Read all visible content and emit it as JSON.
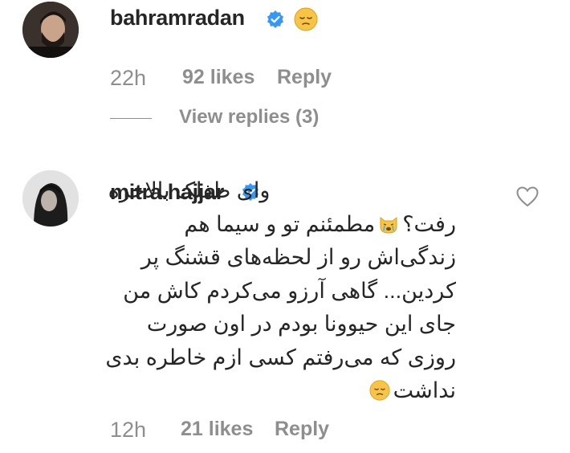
{
  "comments": [
    {
      "username": "bahramradan",
      "verified": true,
      "avatar_icon": "user-avatar",
      "emoji": "pensive-face",
      "time": "22h",
      "likes": "92 likes",
      "reply_label": "Reply",
      "view_replies": "View replies (3)"
    },
    {
      "username": "mitra.hajjar",
      "verified": true,
      "avatar_icon": "user-avatar",
      "text_part1": "وای طفلک بالاخره رفت؟",
      "text_part2": "مطمئنم تو و سیما هم زندگی‌اش رو از لحظه‌های قشنگ پر کردین... گاهی آرزو می‌کردم کاش من جای این حیوونا بودم در اون صورت روزی که می‌رفتم کسی ازم خاطره بدی نداشت",
      "emojis": [
        "crying-cat-face",
        "pensive-face"
      ],
      "like_icon": "heart-icon",
      "time": "12h",
      "likes": "21 likes",
      "reply_label": "Reply"
    }
  ],
  "colors": {
    "text": "#262626",
    "secondary": "#8e8e8e",
    "verified_blue": "#3897f0",
    "emoji_yellow": "#f7c447"
  }
}
